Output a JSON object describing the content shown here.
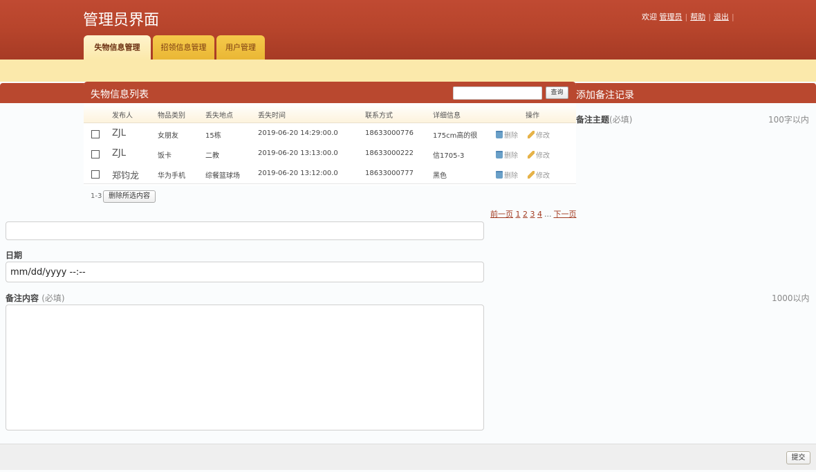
{
  "header": {
    "title": "管理员界面",
    "welcome": "欢迎",
    "user": "管理员",
    "help": "帮助",
    "logout": "退出",
    "sep": "|"
  },
  "tabs": [
    {
      "label": "失物信息管理",
      "active": true
    },
    {
      "label": "招领信息管理",
      "active": false
    },
    {
      "label": "用户管理",
      "active": false
    }
  ],
  "list": {
    "title": "失物信息列表",
    "search_button": "查询",
    "columns": [
      "发布人",
      "物品类别",
      "丢失地点",
      "丢失时间",
      "联系方式",
      "详细信息",
      "操作"
    ],
    "rows": [
      {
        "publisher": "ZJL",
        "category": "女朋友",
        "place": "15栋",
        "time": "2019-06-20 14:29:00.0",
        "phone": "18633000776",
        "detail": "175cm高的很",
        "delete": "删除",
        "edit": "修改"
      },
      {
        "publisher": "ZJL",
        "category": "饭卡",
        "place": "二教",
        "time": "2019-06-20 13:13:00.0",
        "phone": "18633000222",
        "detail": "信1705-3",
        "delete": "删除",
        "edit": "修改"
      },
      {
        "publisher": "郑钧龙",
        "category": "华为手机",
        "place": "综餐篮球场",
        "time": "2019-06-20 13:12:00.0",
        "phone": "18633000777",
        "detail": "黑色",
        "delete": "删除",
        "edit": "修改"
      }
    ],
    "range": "1-3",
    "delete_selected": "删除所选内容"
  },
  "pagination": {
    "prev": "前一页",
    "pages": [
      "1",
      "2",
      "3",
      "4"
    ],
    "ellipsis": "...",
    "next": "下一页"
  },
  "note_form": {
    "title": "添加备注记录",
    "subject_label": "备注主题",
    "subject_hint": "(必填)",
    "subject_limit": "100字以内",
    "date_label": "日期",
    "date_placeholder": "mm/dd/yyyy --:--",
    "content_label": "备注内容",
    "content_hint": "(必填)",
    "content_limit": "1000以内",
    "submit": "提交"
  },
  "colors": {
    "header_red": "#b9482f",
    "tab_yellow": "#f5c94a",
    "sub_bar": "#fbe9ab",
    "link": "#a23a20"
  }
}
